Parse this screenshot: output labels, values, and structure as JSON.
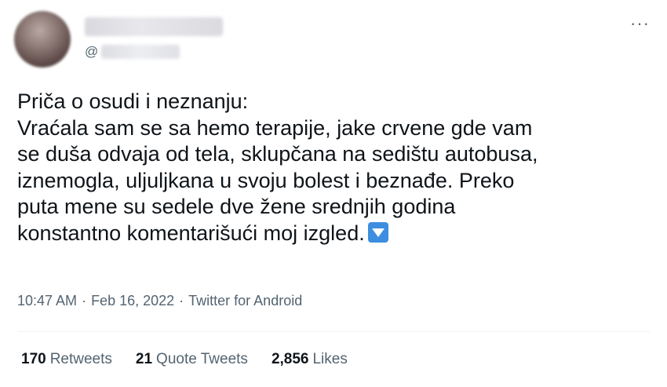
{
  "author": {
    "handle_prefix": "@"
  },
  "menu": {
    "more_label": "···"
  },
  "tweet": {
    "text": "Priča o osudi i neznanju:\nVraćala sam se sa hemo terapije, jake crvene gde vam\nse duša odvaja od tela, sklupčana na sedištu autobusa,\niznemogla, uljuljkana u svoju bolest i beznađe. Preko\nputa mene su sedele dve žene srednjih godina\nkonstantno komentarišući moj izgled.",
    "emoji": "down-arrow-button",
    "time": "10:47 AM",
    "date": "Feb 16, 2022",
    "source": "Twitter for Android",
    "separator": "·"
  },
  "stats": {
    "retweets_count": "170",
    "retweets_label": "Retweets",
    "quotes_count": "21",
    "quotes_label": "Quote Tweets",
    "likes_count": "2,856",
    "likes_label": "Likes"
  },
  "colors": {
    "text_primary": "#0f1419",
    "text_secondary": "#536471",
    "emoji_blue": "#3d8ee0"
  }
}
